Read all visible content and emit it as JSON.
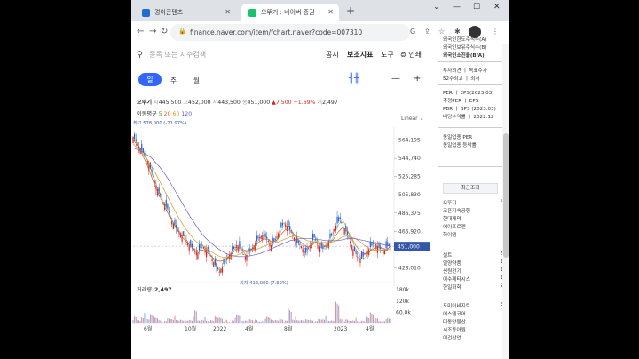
{
  "browser": {
    "tabs": [
      {
        "title": "경이콘텐츠",
        "favicon_color": "#1f6fd1"
      },
      {
        "title": "오뚜기 : 네이버 증권",
        "favicon_color": "#19c36b"
      }
    ],
    "url": "finance.naver.com/item/fchart.naver?code=007310"
  },
  "toolbar": {
    "search_placeholder": "종목 또는 지수검색",
    "items": [
      "공시",
      "보조지표",
      "도구",
      "인쇄"
    ]
  },
  "period_tabs": [
    "일",
    "주",
    "월"
  ],
  "stock": {
    "name": "오뚜기",
    "open_label": "시",
    "open": "445,500",
    "high_label": "고",
    "high": "452,000",
    "low_label": "저",
    "low": "443,500",
    "close_label": "종",
    "close": "451,000",
    "change": "▲7,500",
    "change_pct": "+1.69%",
    "volume_label": "거",
    "volume": "2,497"
  },
  "moving_avg": {
    "label": "이동평균",
    "periods": [
      "5",
      "20",
      "60",
      "120"
    ],
    "colors": [
      "#2aa52a",
      "#e0592b",
      "#d49a1f",
      "#6a5acd"
    ]
  },
  "scale_label": "Linear",
  "chart_data": {
    "type": "line",
    "title": "",
    "y_ticks": [
      "564,195",
      "544,740",
      "525,285",
      "505,830",
      "486,375",
      "466,920",
      "447,465",
      "428,010"
    ],
    "x_ticks": [
      "6월",
      "10월",
      "2022",
      "4월",
      "8월",
      "2023",
      "4월"
    ],
    "ylim": [
      418000,
      578000
    ],
    "current_price": "451,000",
    "high_annotation": "최고 578,000 (-21.97%)",
    "low_annotation": "최저 418,000 (7.89%)",
    "series": [
      {
        "values": [
          568000,
          560000,
          553000,
          546000,
          534000,
          520000,
          508000,
          498000,
          491000,
          478000,
          470000,
          465000,
          460000,
          452000,
          447000,
          444000,
          452000,
          447000,
          441000,
          431000,
          424000,
          432000,
          440000,
          446000,
          452000,
          448000,
          440000,
          445000,
          452000,
          459000,
          463000,
          459000,
          452000,
          458000,
          468000,
          476000,
          471000,
          463000,
          455000,
          451000,
          444000,
          452000,
          460000,
          452000,
          448000,
          454000,
          462000,
          473000,
          480000,
          470000,
          460000,
          448000,
          440000,
          438000,
          444000,
          450000,
          455000,
          449000,
          446000,
          451000
        ]
      },
      {
        "values": [
          565000,
          558000,
          550000,
          540000,
          528000,
          515000,
          505000,
          496000,
          486000,
          478000,
          470000,
          462000,
          457000,
          452000,
          448000,
          446000,
          447000,
          444000,
          440000,
          436000,
          435000,
          436000,
          440000,
          445000,
          449000,
          448000,
          446000,
          447000,
          451000,
          456000,
          459000,
          458000,
          455000,
          458000,
          464000,
          469000,
          468000,
          463000,
          457000,
          453000,
          450000,
          452000,
          456000,
          454000,
          451000,
          454000,
          459000,
          466000,
          471000,
          468000,
          461000,
          452000,
          446000,
          443000,
          444000,
          448000,
          451000,
          449000,
          448000,
          450000
        ]
      },
      {
        "values": [
          560000,
          556000,
          551000,
          545000,
          538000,
          530000,
          521000,
          512000,
          503000,
          494000,
          485000,
          477000,
          470000,
          464000,
          458000,
          454000,
          451000,
          448000,
          445000,
          442000,
          440000,
          439000,
          439000,
          440000,
          442000,
          444000,
          445000,
          446000,
          447000,
          449000,
          451000,
          453000,
          454000,
          455000,
          457000,
          459000,
          461000,
          462000,
          461000,
          459000,
          457000,
          456000,
          455000,
          455000,
          455000,
          455000,
          456000,
          458000,
          461000,
          462000,
          461000,
          459000,
          456000,
          452000,
          449000,
          447000,
          447000,
          447000,
          447000,
          448000
        ]
      },
      {
        "values": [
          556000,
          554000,
          552000,
          549000,
          546000,
          541000,
          536000,
          530000,
          523000,
          515000,
          507000,
          499000,
          491000,
          483000,
          476000,
          469000,
          463000,
          458000,
          454000,
          450000,
          447000,
          444000,
          442000,
          441000,
          440000,
          440000,
          440000,
          441000,
          442000,
          443000,
          445000,
          447000,
          449000,
          451000,
          453000,
          455000,
          457000,
          458000,
          459000,
          459000,
          459000,
          459000,
          458000,
          458000,
          457000,
          457000,
          457000,
          457000,
          458000,
          459000,
          459000,
          459000,
          458000,
          457000,
          456000,
          455000,
          454000,
          453000,
          452000,
          451000
        ]
      }
    ],
    "volume_label": "거래량",
    "volume_value": "2,497",
    "volume_ticks": [
      "180k",
      "120k",
      "60.0k"
    ],
    "volume_ylim": [
      0,
      200000
    ],
    "volume": [
      31000,
      19000,
      47000,
      24000,
      63000,
      27000,
      21000,
      12000,
      29000,
      33000,
      18000,
      26000,
      15000,
      22000,
      59000,
      17000,
      28000,
      13000,
      24000,
      31000,
      36000,
      19000,
      9000,
      25000,
      44000,
      22000,
      14000,
      26000,
      18000,
      12000,
      21000,
      33000,
      27000,
      16000,
      29000,
      14000,
      78000,
      30000,
      17000,
      24000,
      19000,
      22000,
      11000,
      26000,
      33000,
      15000,
      21000,
      97000,
      28000,
      19000,
      16000,
      25000,
      12000,
      20000,
      29000,
      66000,
      24000,
      14000,
      20000,
      27000
    ]
  },
  "right_panel": {
    "top_items": [
      "외국인한도주식수(A)",
      "외국인보유주식수(B)",
      "외국인소진율(B/A)"
    ],
    "target_label": "투자의견 ㅣ 목표주가",
    "week52_label": "52주최고 ㅣ 최저",
    "per_label": "PER ㅣ EPS(2023.03)",
    "est_per_label": "추정PER ㅣ EPS",
    "pbr_label": "PBR ㅣ BPS (2023.03)",
    "div_label": "배당수익률 ㅣ 2022.12",
    "peer_label": "동일업종 PER",
    "peer_rate_label": "동일업종 등락률",
    "recent_header": "최근조회",
    "recent_items": [
      {
        "name": "오뚜기",
        "num": "45"
      },
      {
        "name": "코픈지속공행",
        "num": ""
      },
      {
        "name": "현대제약",
        "num": ""
      },
      {
        "name": "에이프로젠",
        "num": ""
      },
      {
        "name": "하이엠",
        "num": ""
      },
      {
        "name": "셀트",
        "num": "5"
      },
      {
        "name": "일양약품",
        "num": "1"
      },
      {
        "name": "신원전기",
        "num": "1"
      },
      {
        "name": "이수페타시스",
        "num": "1"
      },
      {
        "name": "한일화학",
        "num": "2"
      },
      {
        "name": "포미이비지트",
        "num": "3"
      },
      {
        "name": "에스엠코어",
        "num": ""
      },
      {
        "name": "대동앙물산",
        "num": ""
      },
      {
        "name": "시조동아원",
        "num": ""
      },
      {
        "name": "이건산업",
        "num": ""
      }
    ]
  }
}
